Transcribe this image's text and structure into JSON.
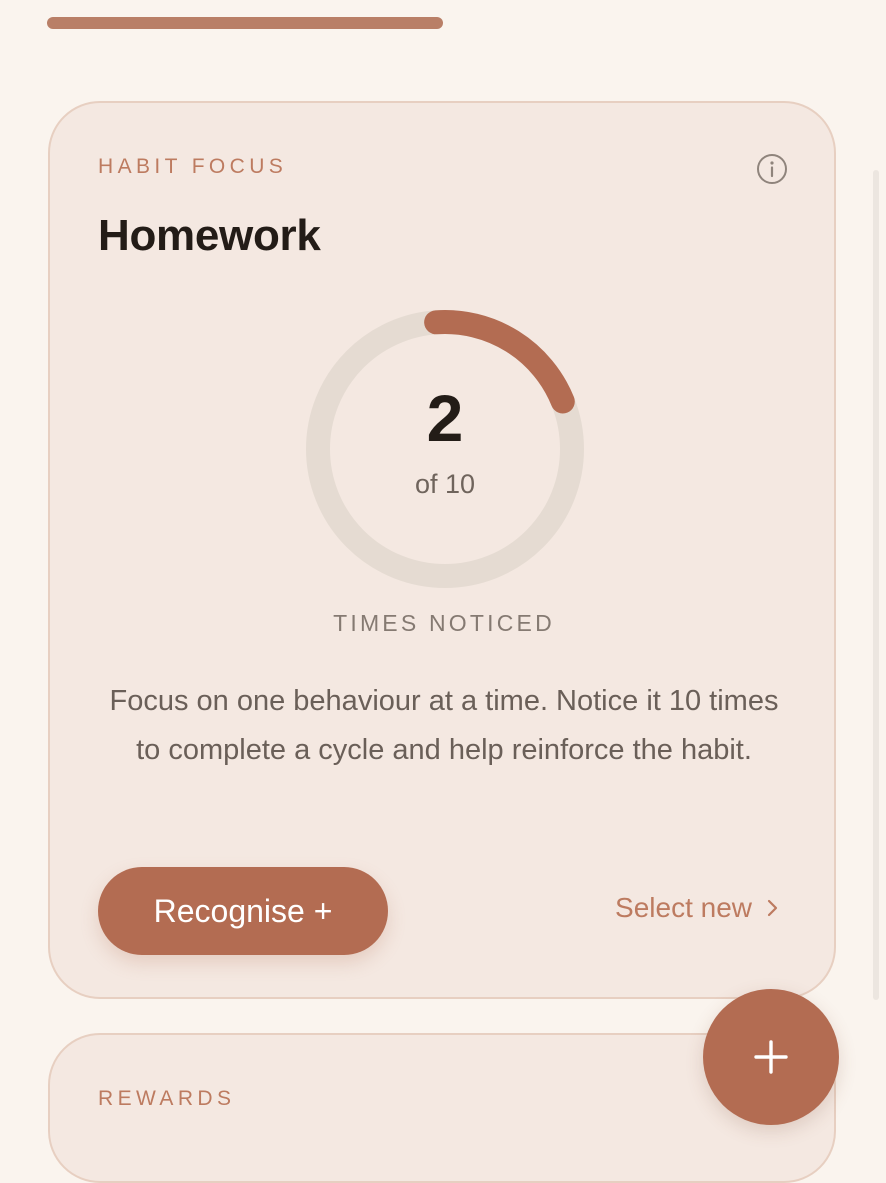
{
  "habit_card": {
    "eyebrow": "HABIT FOCUS",
    "title": "Homework",
    "progress": {
      "count": "2",
      "of_text": "of 10",
      "current": 2,
      "target": 10,
      "label": "TIMES NOTICED"
    },
    "description": "Focus on one behaviour at a time. Notice it 10 times to complete a cycle and help reinforce the habit.",
    "recognise_label": "Recognise +",
    "select_new_label": "Select new"
  },
  "rewards_card": {
    "eyebrow": "REWARDS"
  },
  "icons": {
    "info": "info-icon",
    "chevron": "chevron-right-icon",
    "fab": "plus-icon"
  },
  "colors": {
    "accent": "#b36c52",
    "ring_track": "#e5dbd2",
    "card_background": "#f4e8e1",
    "page_background": "#faf4ee"
  }
}
